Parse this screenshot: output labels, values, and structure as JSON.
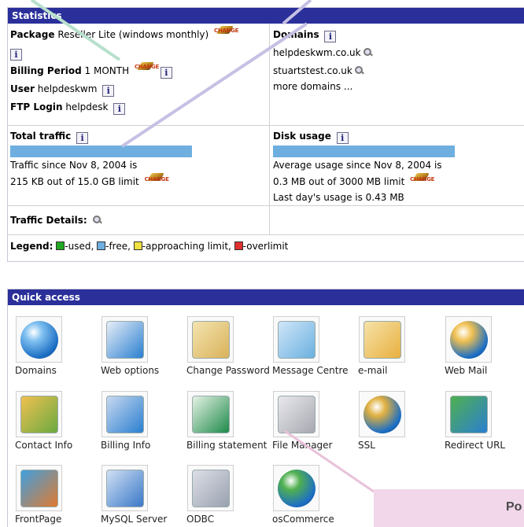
{
  "statistics": {
    "title": "Statistics",
    "package_label": "Package",
    "package_value": "Reseller Lite (windows monthly)",
    "domains_label": "Domains",
    "domains": [
      "helpdeskwm.co.uk",
      "stuartstest.co.uk"
    ],
    "more_domains": "more domains ...",
    "billing_label": "Billing Period",
    "billing_value": "1 MONTH",
    "user_label": "User",
    "user_value": "helpdeskwm",
    "ftp_label": "FTP Login",
    "ftp_value": "helpdesk",
    "total_traffic_label": "Total traffic",
    "traffic_since": "Traffic since Nov 8, 2004 is",
    "traffic_usage": "215 KB out of 15.0 GB limit",
    "traffic_used_fraction": 0.0,
    "disk_usage_label": "Disk usage",
    "disk_since": "Average usage since Nov 8, 2004 is",
    "disk_usage": "0.3 MB out of 3000 MB limit",
    "disk_used_fraction": 0.0,
    "disk_last_day": "Last day's usage is 0.43 MB",
    "traffic_details_label": "Traffic Details:",
    "legend_label": "Legend:",
    "legend_items": [
      "-used,",
      "-free,",
      "-approaching limit,",
      "-overlimit"
    ],
    "legend_colors": [
      "#22a822",
      "#6eafe0",
      "#f0e040",
      "#e03030"
    ],
    "change_text": "CHANGE",
    "info_text": "i"
  },
  "quick_access": {
    "title": "Quick access",
    "items": [
      {
        "label": "Domains",
        "icon": "globe-icon"
      },
      {
        "label": "Web options",
        "icon": "web-options-icon"
      },
      {
        "label": "Change Password",
        "icon": "key-icon"
      },
      {
        "label": "Message Centre",
        "icon": "folder-icon"
      },
      {
        "label": "e-mail",
        "icon": "email-icon"
      },
      {
        "label": "Web Mail",
        "icon": "webmail-icon"
      },
      {
        "label": "Contact Info",
        "icon": "contact-icon"
      },
      {
        "label": "Billing Info",
        "icon": "billing-info-icon"
      },
      {
        "label": "Billing statement",
        "icon": "billing-statement-icon"
      },
      {
        "label": "File Manager",
        "icon": "file-manager-icon"
      },
      {
        "label": "SSL",
        "icon": "ssl-icon"
      },
      {
        "label": "Redirect URL",
        "icon": "redirect-icon"
      },
      {
        "label": "FrontPage",
        "icon": "frontpage-icon"
      },
      {
        "label": "MySQL Server",
        "icon": "mysql-icon"
      },
      {
        "label": "ODBC",
        "icon": "odbc-icon"
      },
      {
        "label": "osCommerce",
        "icon": "oscommerce-icon"
      }
    ]
  },
  "overlay": {
    "text": "Po"
  }
}
